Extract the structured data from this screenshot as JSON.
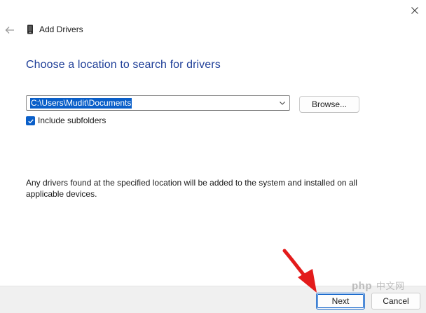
{
  "window": {
    "title": "Add Drivers",
    "close_icon": "close-icon",
    "back_icon": "back-arrow-icon",
    "app_icon": "device-icon"
  },
  "main": {
    "heading": "Choose a location to search for drivers",
    "path": {
      "value": "C:\\Users\\Mudit\\Documents",
      "dropdown_icon": "chevron-down-icon"
    },
    "browse_label": "Browse...",
    "include_subfolders": {
      "label": "Include subfolders",
      "checked": true
    },
    "info_line1": "Any drivers found at the specified location will be added to the system and installed on all",
    "info_line2": "applicable devices."
  },
  "footer": {
    "next_label": "Next",
    "cancel_label": "Cancel"
  },
  "annotation": {
    "arrow_icon": "red-pointer-arrow-icon",
    "arrow_color": "#e31b1b"
  },
  "watermark": {
    "brand": "php",
    "text": "中文网"
  },
  "colors": {
    "accent": "#0a5fc9",
    "heading": "#1f3f98"
  }
}
